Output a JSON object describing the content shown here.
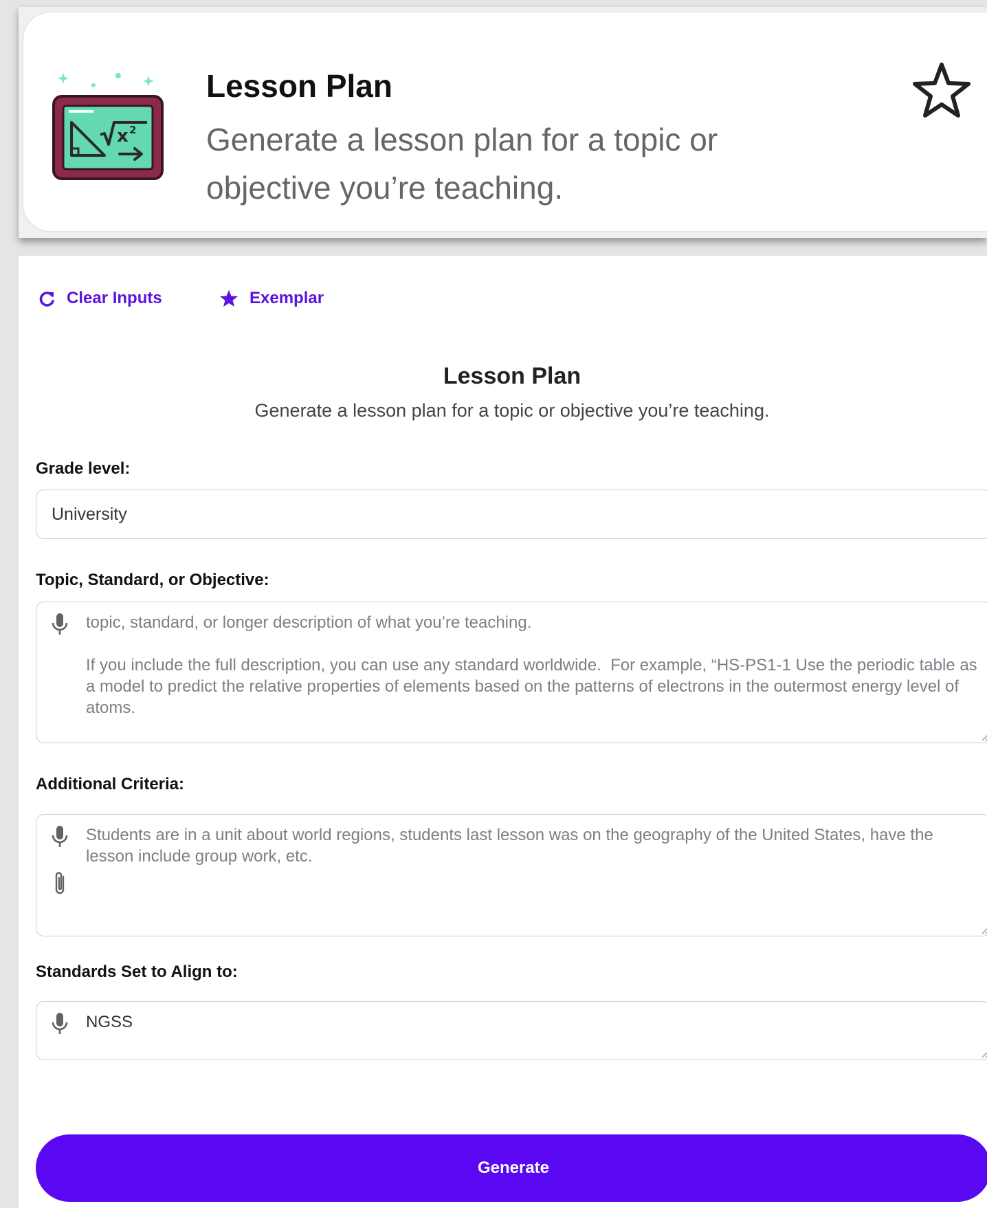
{
  "tool_card": {
    "title": "Lesson Plan",
    "description": "Generate a lesson plan for a topic or objective you’re teaching.",
    "logo_icon": "chalkboard-math-icon",
    "favorite_icon": "star-outline-icon"
  },
  "actions": {
    "clear_inputs": "Clear Inputs",
    "exemplar": "Exemplar"
  },
  "form": {
    "title": "Lesson Plan",
    "subtitle": "Generate a lesson plan for a topic or objective you’re teaching.",
    "grade_level": {
      "label": "Grade level:",
      "value": "University"
    },
    "topic": {
      "label": "Topic, Standard, or Objective:",
      "placeholder": "topic, standard, or longer description of what you’re teaching.\n\nIf you include the full description, you can use any standard worldwide.  For example, “HS-PS1-1 Use the periodic table as a model to predict the relative properties of elements based on the patterns of electrons in the outermost energy level of atoms."
    },
    "additional_criteria": {
      "label": "Additional Criteria:",
      "placeholder": "Students are in a unit about world regions, students last lesson was on the geography of the United States, have the lesson include group work, etc."
    },
    "standards_set": {
      "label": "Standards Set to Align to:",
      "value": "NGSS"
    },
    "generate_button": "Generate"
  },
  "colors": {
    "accent": "#5b08f2",
    "link": "#5b13e0",
    "logo_screen": "#63d8b3",
    "logo_frame": "#8a2a4a"
  }
}
